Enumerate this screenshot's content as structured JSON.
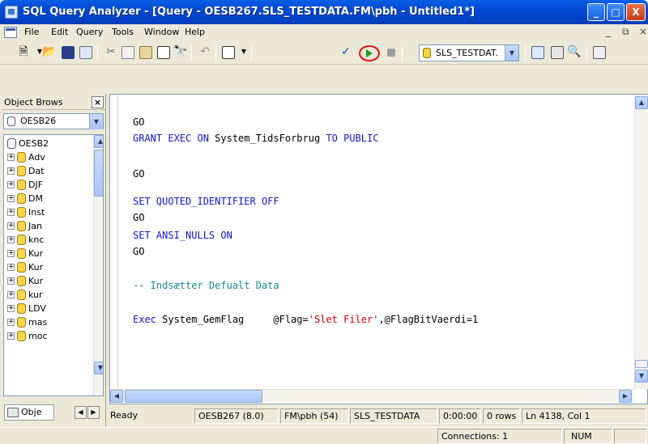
{
  "window": {
    "title": "SQL Query Analyzer - [Query - OESB267.SLS_TESTDATA.FM\\pbh - Untitled1*]"
  },
  "window_controls": {
    "minimize": "_",
    "maximize": "□",
    "close": "X"
  },
  "menu": {
    "items": [
      "File",
      "Edit",
      "Query",
      "Tools",
      "Window",
      "Help"
    ]
  },
  "mdi_controls": {
    "minimize": "_",
    "restore": "⧉",
    "close": "×"
  },
  "toolbar": {
    "database": "SLS_TESTDAT."
  },
  "object_browser": {
    "title": "Object Brows",
    "server": "OESB26",
    "tree_root": "OESB2",
    "items": [
      "Adv",
      "Dat",
      "DJF",
      "DM",
      "Inst",
      "Jan",
      "knc",
      "Kur",
      "Kur",
      "Kur",
      "kur",
      "LDV",
      "mas",
      "moc"
    ],
    "tab_label": "Obje"
  },
  "editor": {
    "lines": [
      {
        "parts": [
          {
            "t": "GO",
            "c": "gr"
          }
        ]
      },
      {
        "parts": [
          {
            "t": "GRANT EXEC ON ",
            "c": "kw"
          },
          {
            "t": "System_TidsForbrug ",
            "c": "gr"
          },
          {
            "t": "TO PUBLIC",
            "c": "kw"
          }
        ]
      },
      {
        "parts": []
      },
      {
        "parts": [
          {
            "t": "GO",
            "c": "gr"
          }
        ]
      },
      {
        "parts": []
      },
      {
        "parts": [
          {
            "t": "SET QUOTED_IDENTIFIER OFF",
            "c": "kw"
          }
        ]
      },
      {
        "parts": [
          {
            "t": "GO",
            "c": "gr"
          }
        ]
      },
      {
        "parts": [
          {
            "t": "SET ANSI_NULLS ON",
            "c": "kw"
          }
        ]
      },
      {
        "parts": [
          {
            "t": "GO",
            "c": "gr"
          }
        ]
      },
      {
        "parts": []
      },
      {
        "parts": [
          {
            "t": "-- Indsætter Defualt Data",
            "c": "cm"
          }
        ]
      },
      {
        "parts": []
      },
      {
        "parts": [
          {
            "t": "Exec ",
            "c": "kw"
          },
          {
            "t": "System_GemFlag     @Flag=",
            "c": "gr"
          },
          {
            "t": "'Slet Filer'",
            "c": "str"
          },
          {
            "t": ",@FlagBitVaerdi=1",
            "c": "gr"
          }
        ]
      }
    ]
  },
  "status": {
    "state": "Ready",
    "server": "OESB267 (8.0)",
    "user": "FM\\pbh (54)",
    "database": "SLS_TESTDATA",
    "elapsed": "0:00:00",
    "rows": "0 rows",
    "position": "Ln 4138, Col 1",
    "connections": "Connections: 1",
    "num": "NUM"
  }
}
